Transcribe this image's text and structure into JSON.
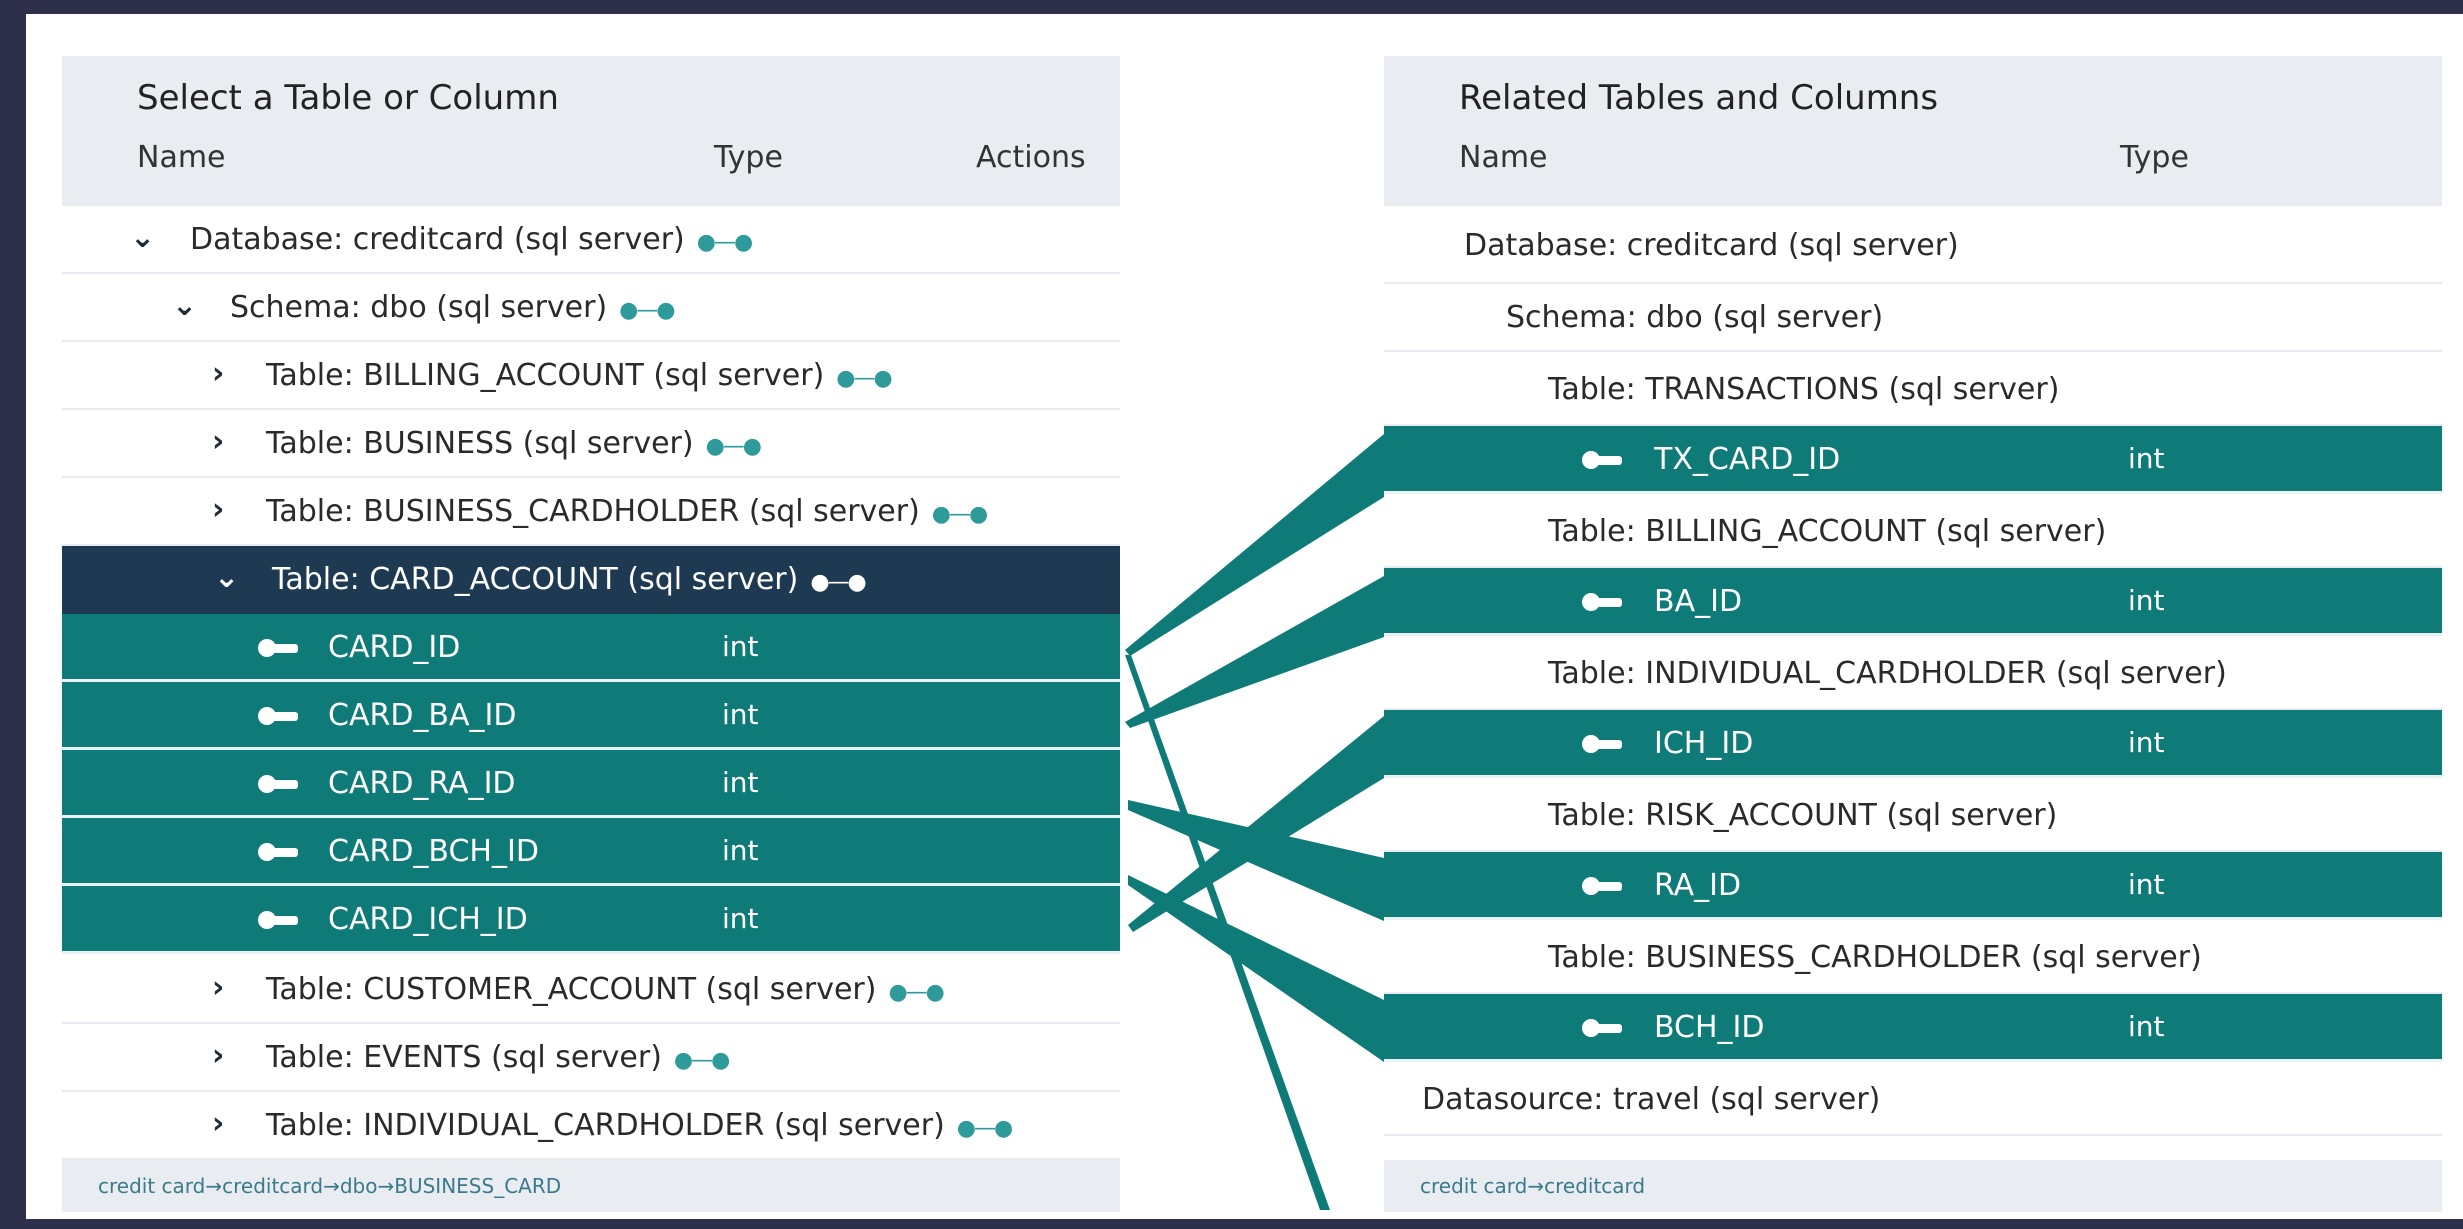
{
  "left_panel": {
    "title": "Select a Table or Column",
    "columns": {
      "name": "Name",
      "type": "Type",
      "actions": "Actions"
    },
    "rows": {
      "database": "Database: creditcard (sql server)",
      "schema": "Schema: dbo (sql server)",
      "t_billing": "Table: BILLING_ACCOUNT (sql server)",
      "t_business": "Table: BUSINESS (sql server)",
      "t_business_cardholder": "Table: BUSINESS_CARDHOLDER (sql server)",
      "t_card_account": "Table: CARD_ACCOUNT (sql server)",
      "t_customer_account": "Table: CUSTOMER_ACCOUNT (sql server)",
      "t_events": "Table: EVENTS (sql server)",
      "t_individual_cardholder": "Table: INDIVIDUAL_CARDHOLDER (sql server)"
    },
    "columns_list": [
      {
        "name": "CARD_ID",
        "type": "int"
      },
      {
        "name": "CARD_BA_ID",
        "type": "int"
      },
      {
        "name": "CARD_RA_ID",
        "type": "int"
      },
      {
        "name": "CARD_BCH_ID",
        "type": "int"
      },
      {
        "name": "CARD_ICH_ID",
        "type": "int"
      }
    ],
    "breadcrumb": "credit card→creditcard→dbo→BUSINESS_CARD"
  },
  "right_panel": {
    "title": "Related Tables and Columns",
    "columns": {
      "name": "Name",
      "type": "Type"
    },
    "database": "Database: creditcard (sql server)",
    "schema": "Schema: dbo (sql server)",
    "tables": [
      {
        "label": "Table: TRANSACTIONS (sql server)",
        "column": "TX_CARD_ID",
        "type": "int"
      },
      {
        "label": "Table: BILLING_ACCOUNT (sql server)",
        "column": "BA_ID",
        "type": "int"
      },
      {
        "label": "Table: INDIVIDUAL_CARDHOLDER (sql server)",
        "column": "ICH_ID",
        "type": "int"
      },
      {
        "label": "Table: RISK_ACCOUNT (sql server)",
        "column": "RA_ID",
        "type": "int"
      },
      {
        "label": "Table: BUSINESS_CARDHOLDER (sql server)",
        "column": "BCH_ID",
        "type": "int"
      }
    ],
    "datasource": "Datasource: travel (sql server)",
    "breadcrumb": "credit card→creditcard"
  },
  "icons": {
    "expand": "chevron-down-icon",
    "collapse": "chevron-right-icon",
    "key": "key-icon",
    "actions": "link-dots-icon"
  },
  "colors": {
    "teal": "#0f7b78",
    "selected_navy": "#1e3a52",
    "header_bg": "#e9edf2",
    "frame": "#2e2f4a"
  }
}
